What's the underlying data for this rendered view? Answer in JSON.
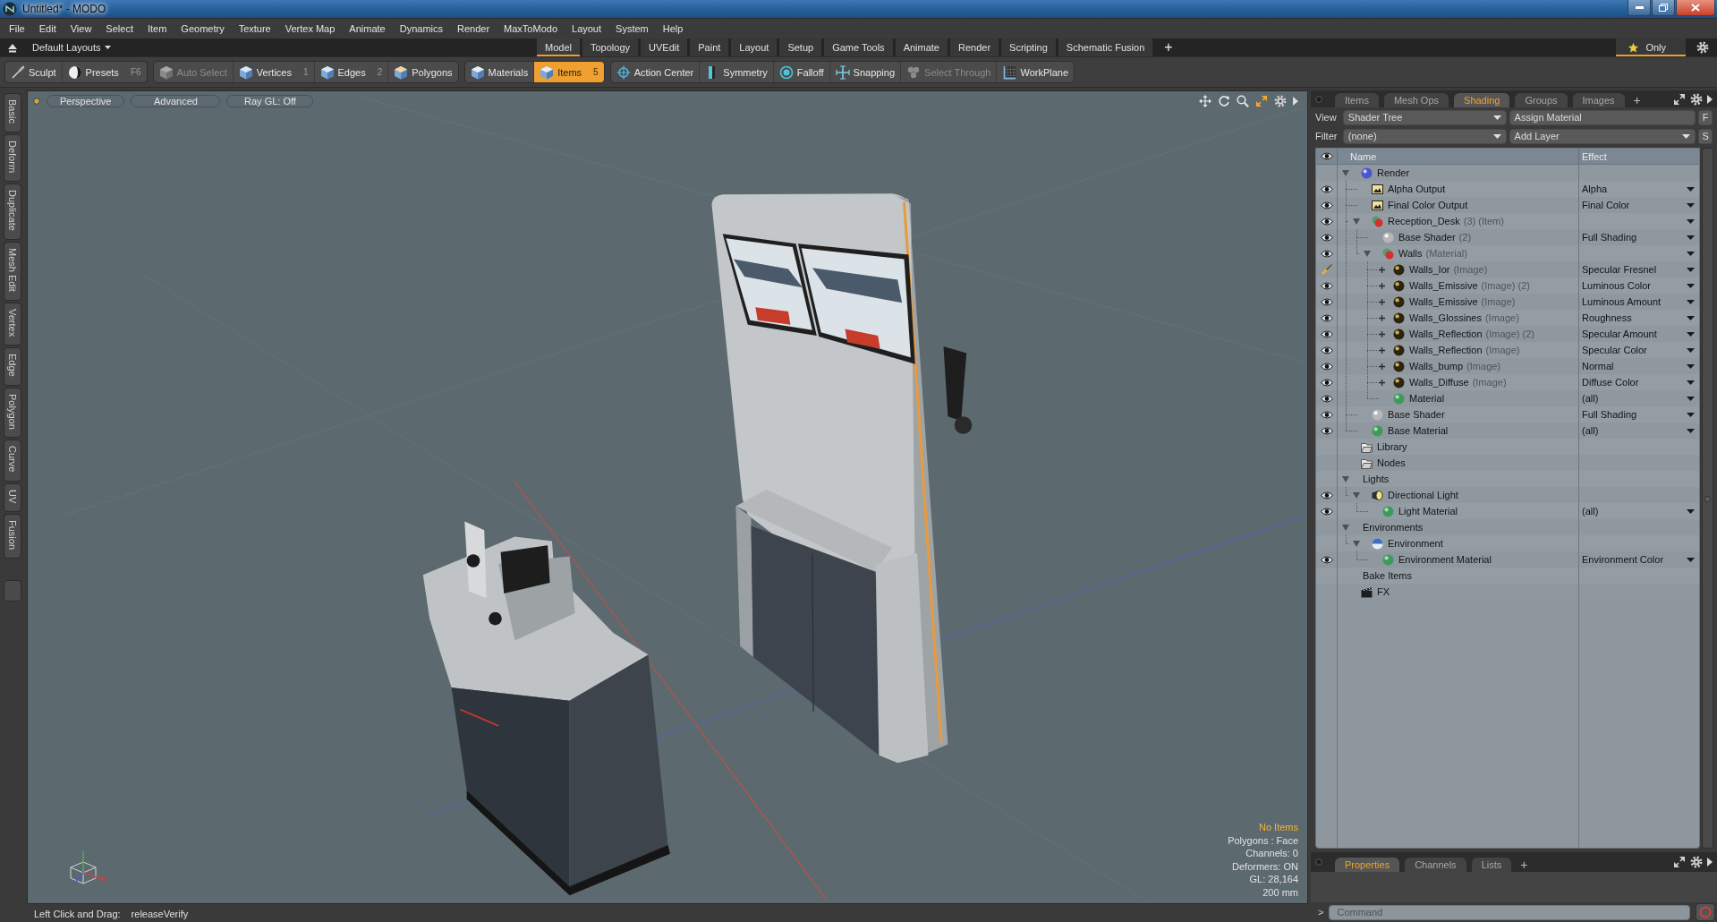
{
  "window": {
    "title": "Untitled* - MODO"
  },
  "menu": [
    "File",
    "Edit",
    "View",
    "Select",
    "Item",
    "Geometry",
    "Texture",
    "Vertex Map",
    "Animate",
    "Dynamics",
    "Render",
    "MaxToModo",
    "Layout",
    "System",
    "Help"
  ],
  "layout_bar": {
    "layouts": "Default Layouts",
    "tabs": [
      {
        "label": "Model",
        "selected": true
      },
      {
        "label": "Topology",
        "selected": false
      },
      {
        "label": "UVEdit",
        "selected": false
      },
      {
        "label": "Paint",
        "selected": false
      },
      {
        "label": "Layout",
        "selected": false
      },
      {
        "label": "Setup",
        "selected": false
      },
      {
        "label": "Game Tools",
        "selected": false
      },
      {
        "label": "Animate",
        "selected": false
      },
      {
        "label": "Render",
        "selected": false
      },
      {
        "label": "Scripting",
        "selected": false
      },
      {
        "label": "Schematic Fusion",
        "selected": false
      }
    ],
    "add": "+",
    "only": {
      "label": "Only",
      "on": true
    }
  },
  "toolbar": {
    "groups": [
      {
        "tools": [
          {
            "kind": "sculpt",
            "label": "Sculpt",
            "selected": false,
            "disabled": false
          },
          {
            "kind": "presets",
            "label": "Presets",
            "shortcut": "F6",
            "selected": false,
            "disabled": false
          }
        ]
      },
      {
        "tools": [
          {
            "kind": "auto_select",
            "label": "Auto Select",
            "selected": false,
            "disabled": true
          },
          {
            "kind": "vertices",
            "label": "Vertices",
            "shortcut": "1",
            "selected": false,
            "disabled": false
          },
          {
            "kind": "edges",
            "label": "Edges",
            "shortcut": "2",
            "selected": false,
            "disabled": false
          },
          {
            "kind": "polygons",
            "label": "Polygons",
            "selected": false,
            "disabled": false
          }
        ]
      },
      {
        "tools": [
          {
            "kind": "materials",
            "label": "Materials",
            "selected": false,
            "disabled": false
          },
          {
            "kind": "items",
            "label": "Items",
            "shortcut": "5",
            "selected": true,
            "disabled": false
          }
        ]
      },
      {
        "tools": [
          {
            "kind": "action_center",
            "label": "Action Center",
            "selected": false,
            "disabled": false
          },
          {
            "kind": "symmetry",
            "label": "Symmetry",
            "selected": false,
            "disabled": false
          },
          {
            "kind": "falloff",
            "label": "Falloff",
            "selected": false,
            "disabled": false
          },
          {
            "kind": "snapping",
            "label": "Snapping",
            "selected": false,
            "disabled": false
          },
          {
            "kind": "select_through",
            "label": "Select Through",
            "selected": false,
            "disabled": true
          },
          {
            "kind": "workplane",
            "label": "WorkPlane",
            "selected": false,
            "disabled": false
          }
        ]
      }
    ]
  },
  "side_tabs": [
    "Basic",
    "Deform",
    "Duplicate",
    "Mesh Edit",
    "Vertex",
    "Edge",
    "Polygon",
    "Curve",
    "UV",
    "Fusion"
  ],
  "viewport": {
    "buttons": [
      "Perspective",
      "Advanced",
      "Ray GL: Off"
    ],
    "info": [
      {
        "text": "No Items",
        "highlight": true
      },
      {
        "text": "Polygons : Face",
        "highlight": false
      },
      {
        "text": "Channels: 0",
        "highlight": false
      },
      {
        "text": "Deformers: ON",
        "highlight": false
      },
      {
        "text": "GL: 28,164",
        "highlight": false
      },
      {
        "text": "200 mm",
        "highlight": false
      }
    ]
  },
  "status_bar": {
    "hint": "Left Click and Drag:",
    "action": "releaseVerify"
  },
  "right_panel": {
    "tabs": [
      {
        "label": "Items",
        "selected": false
      },
      {
        "label": "Mesh Ops",
        "selected": false
      },
      {
        "label": "Shading",
        "selected": true
      },
      {
        "label": "Groups",
        "selected": false
      },
      {
        "label": "Images",
        "selected": false
      }
    ],
    "add": "+",
    "view": {
      "label": "View",
      "value": "Shader Tree"
    },
    "assign": "Assign Material",
    "f_button": "F",
    "filter": {
      "label": "Filter",
      "value": "(none)"
    },
    "add_layer": "Add Layer",
    "s_button": "S",
    "tree": {
      "columns": [
        "Name",
        "Effect"
      ],
      "rows": [
        {
          "kind": "render",
          "name": "Render",
          "visible": false,
          "expanded": true,
          "children": [
            {
              "kind": "output",
              "name": "Alpha Output",
              "visible": true,
              "effect": "Alpha",
              "dropdown": true
            },
            {
              "kind": "output",
              "name": "Final Color Output",
              "visible": true,
              "effect": "Final Color",
              "dropdown": true
            },
            {
              "kind": "group",
              "name": "Reception_Desk",
              "note": "(3) (Item)",
              "visible": true,
              "expanded": true,
              "dropdown": true,
              "children": [
                {
                  "kind": "shader",
                  "name": "Base Shader",
                  "note": "(2)",
                  "visible": true,
                  "effect": "Full Shading",
                  "dropdown": true
                },
                {
                  "kind": "group",
                  "name": "Walls",
                  "note": "(Material)",
                  "visible": true,
                  "expanded": true,
                  "dropdown": true,
                  "children": [
                    {
                      "kind": "image",
                      "name": "Walls_Ior",
                      "note": "(Image)",
                      "visible": true,
                      "brush": true,
                      "expanded": false,
                      "effect": "Specular Fresnel",
                      "dropdown": true
                    },
                    {
                      "kind": "image",
                      "name": "Walls_Emissive",
                      "note": "(Image) (2)",
                      "visible": true,
                      "expanded": false,
                      "effect": "Luminous Color",
                      "dropdown": true
                    },
                    {
                      "kind": "image",
                      "name": "Walls_Emissive",
                      "note": "(Image)",
                      "visible": true,
                      "expanded": false,
                      "effect": "Luminous Amount",
                      "dropdown": true
                    },
                    {
                      "kind": "image",
                      "name": "Walls_Glossines",
                      "note": "(Image)",
                      "visible": true,
                      "expanded": false,
                      "effect": "Roughness",
                      "dropdown": true
                    },
                    {
                      "kind": "image",
                      "name": "Walls_Reflection",
                      "note": "(Image) (2)",
                      "visible": true,
                      "expanded": false,
                      "effect": "Specular Amount",
                      "dropdown": true
                    },
                    {
                      "kind": "image",
                      "name": "Walls_Reflection",
                      "note": "(Image)",
                      "visible": true,
                      "expanded": false,
                      "effect": "Specular Color",
                      "dropdown": true
                    },
                    {
                      "kind": "image",
                      "name": "Walls_bump",
                      "note": "(Image)",
                      "visible": true,
                      "expanded": false,
                      "effect": "Normal",
                      "dropdown": true
                    },
                    {
                      "kind": "image",
                      "name": "Walls_Diffuse",
                      "note": "(Image)",
                      "visible": true,
                      "expanded": false,
                      "effect": "Diffuse Color",
                      "dropdown": true
                    },
                    {
                      "kind": "material",
                      "name": "Material",
                      "visible": true,
                      "effect": "(all)",
                      "dropdown": true
                    }
                  ]
                }
              ]
            },
            {
              "kind": "shader",
              "name": "Base Shader",
              "visible": true,
              "effect": "Full Shading",
              "dropdown": true
            },
            {
              "kind": "material",
              "name": "Base Material",
              "visible": true,
              "effect": "(all)",
              "dropdown": true
            }
          ]
        },
        {
          "kind": "folder",
          "name": "Library",
          "visible": false
        },
        {
          "kind": "folder",
          "name": "Nodes",
          "visible": false
        },
        {
          "kind": "label",
          "name": "Lights",
          "visible": false,
          "expanded": true,
          "children": [
            {
              "kind": "light",
              "name": "Directional Light",
              "visible": true,
              "expanded": true,
              "children": [
                {
                  "kind": "material",
                  "name": "Light Material",
                  "visible": true,
                  "effect": "(all)",
                  "dropdown": true
                }
              ]
            }
          ]
        },
        {
          "kind": "label",
          "name": "Environments",
          "visible": false,
          "expanded": true,
          "children": [
            {
              "kind": "environment",
              "name": "Environment",
              "visible": false,
              "expanded": true,
              "children": [
                {
                  "kind": "material",
                  "name": "Environment Material",
                  "visible": true,
                  "effect": "Environment Color",
                  "dropdown": true
                }
              ]
            }
          ]
        },
        {
          "kind": "label",
          "name": "Bake Items",
          "visible": false
        },
        {
          "kind": "effect",
          "name": "FX",
          "visible": false
        }
      ]
    }
  },
  "bottom_panel": {
    "tabs": [
      {
        "label": "Properties",
        "selected": true
      },
      {
        "label": "Channels",
        "selected": false
      },
      {
        "label": "Lists",
        "selected": false
      }
    ],
    "add": "+"
  },
  "command": {
    "prompt": ">",
    "placeholder": "Command"
  }
}
